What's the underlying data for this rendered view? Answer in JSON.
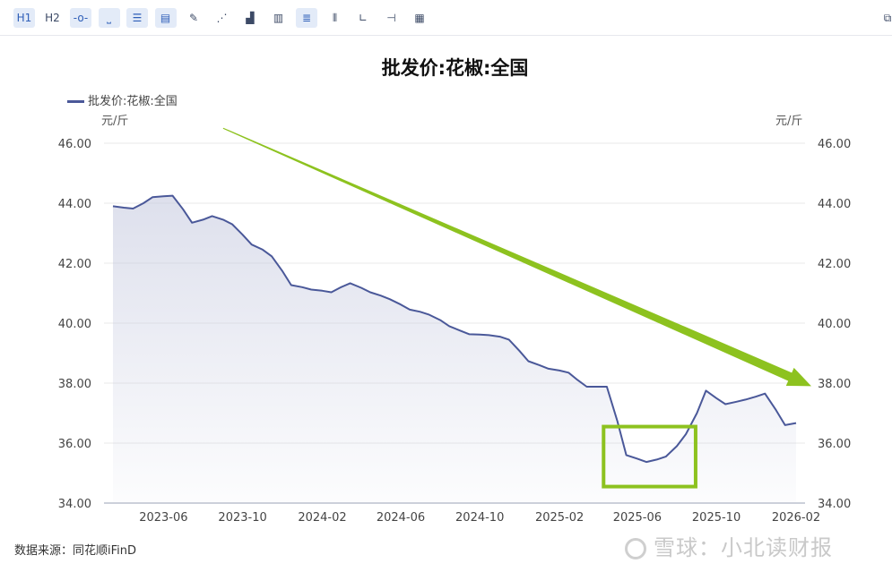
{
  "toolbar": {
    "buttons": [
      {
        "name": "h1-button",
        "label": "H1",
        "active": true
      },
      {
        "name": "h2-button",
        "label": "H2",
        "active": false
      },
      {
        "name": "line-point-button",
        "label": "-o-",
        "active": true
      },
      {
        "name": "spacing-button",
        "label": "⎵",
        "active": true
      },
      {
        "name": "list-button",
        "label": "☰",
        "active": true
      },
      {
        "name": "document-button",
        "label": "▤",
        "active": true
      },
      {
        "name": "edit-button",
        "label": "✎",
        "active": false
      },
      {
        "name": "scatter-button",
        "label": "⋰",
        "active": false
      },
      {
        "name": "bar-chart-button",
        "label": "▟",
        "active": false
      },
      {
        "name": "file-button",
        "label": "▥",
        "active": false
      },
      {
        "name": "align-button",
        "label": "≣",
        "active": true
      },
      {
        "name": "columns-button",
        "label": "⦀",
        "active": false
      },
      {
        "name": "axis-button",
        "label": "∟",
        "active": false
      },
      {
        "name": "dual-axis-button",
        "label": "⊣",
        "active": false
      },
      {
        "name": "table-button",
        "label": "▦",
        "active": false
      },
      {
        "name": "fullscreen-button",
        "label": "⧉",
        "active": false
      }
    ]
  },
  "unit_left": "元/斤",
  "unit_right": "元/斤",
  "source": "数据来源：同花顺iFinD",
  "watermark": "雪球：小北读财报",
  "colors": {
    "line": "#4a5899",
    "fill_top": "#c7cbe0",
    "annotation": "#8dc21f",
    "grid": "#e8e8e8"
  },
  "chart_data": {
    "type": "area",
    "title": "批发价:花椒:全国",
    "series": [
      {
        "name": "批发价:花椒:全国",
        "x": [
          "2023-03-15",
          "2023-04-01",
          "2023-04-15",
          "2023-05-01",
          "2023-05-15",
          "2023-06-01",
          "2023-06-15",
          "2023-07-01",
          "2023-07-15",
          "2023-08-01",
          "2023-08-15",
          "2023-09-01",
          "2023-09-15",
          "2023-10-01",
          "2023-10-15",
          "2023-11-01",
          "2023-11-15",
          "2023-12-01",
          "2023-12-15",
          "2024-01-01",
          "2024-01-15",
          "2024-02-01",
          "2024-02-15",
          "2024-03-01",
          "2024-03-15",
          "2024-04-01",
          "2024-04-15",
          "2024-05-01",
          "2024-05-15",
          "2024-06-01",
          "2024-06-15",
          "2024-07-01",
          "2024-07-15",
          "2024-08-01",
          "2024-08-15",
          "2024-09-01",
          "2024-09-15",
          "2024-10-01",
          "2024-10-15",
          "2024-11-01",
          "2024-11-15",
          "2024-12-01",
          "2024-12-15",
          "2025-01-01",
          "2025-01-15",
          "2025-02-01",
          "2025-02-15",
          "2025-03-01",
          "2025-03-15",
          "2025-04-01",
          "2025-04-15",
          "2025-05-01",
          "2025-05-15",
          "2025-06-01",
          "2025-06-15",
          "2025-07-01",
          "2025-07-15",
          "2025-08-01",
          "2025-08-15",
          "2025-09-01",
          "2025-09-15",
          "2025-10-01",
          "2025-10-15",
          "2025-11-01",
          "2025-11-15",
          "2025-12-01",
          "2025-12-15",
          "2026-01-01",
          "2026-01-15",
          "2026-02-01"
        ],
        "values": [
          43.9,
          43.85,
          43.82,
          44.0,
          44.2,
          44.23,
          44.25,
          43.8,
          43.35,
          43.45,
          43.57,
          43.45,
          43.3,
          42.95,
          42.62,
          42.45,
          42.23,
          41.75,
          41.27,
          41.2,
          41.12,
          41.08,
          41.03,
          41.2,
          41.33,
          41.18,
          41.03,
          40.92,
          40.8,
          40.62,
          40.45,
          40.38,
          40.28,
          40.1,
          39.9,
          39.75,
          39.63,
          39.62,
          39.6,
          39.55,
          39.45,
          39.08,
          38.73,
          38.6,
          38.48,
          38.42,
          38.35,
          38.1,
          37.88,
          37.88,
          37.88,
          36.75,
          35.6,
          35.48,
          35.37,
          35.45,
          35.55,
          35.9,
          36.3,
          37.0,
          37.75,
          37.5,
          37.3,
          37.38,
          37.45,
          37.55,
          37.65,
          37.1,
          36.6,
          36.67
        ]
      }
    ],
    "x_tick_labels": [
      "2023-06",
      "2023-10",
      "2024-02",
      "2024-06",
      "2024-10",
      "2025-02",
      "2025-06",
      "2025-10",
      "2026-02"
    ],
    "y_ticks": [
      "34.00",
      "36.00",
      "38.00",
      "40.00",
      "42.00",
      "44.00",
      "46.00"
    ],
    "ylim": [
      34,
      46
    ],
    "xlim": [
      "2023-03-15",
      "2026-02-01"
    ],
    "legend": "top-left",
    "grid": true,
    "annotations": [
      {
        "type": "arrow",
        "from": [
          "2023-09-01",
          46.5
        ],
        "to": [
          "2026-02-01",
          37.9
        ]
      },
      {
        "type": "rectangle",
        "x": [
          "2025-04-10",
          "2025-08-30"
        ],
        "y": [
          34.55,
          36.55
        ]
      }
    ]
  }
}
